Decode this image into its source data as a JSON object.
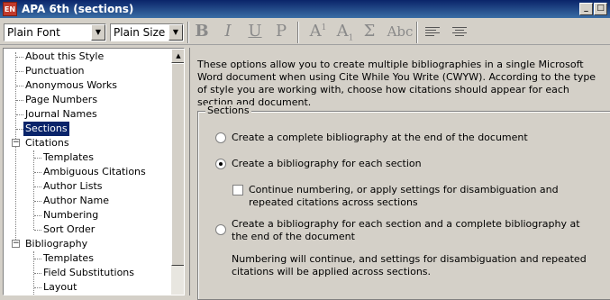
{
  "window": {
    "title": "APA 6th (sections)",
    "app_icon_text": "EN",
    "minimize_glyph": "_",
    "restore_glyph": "□",
    "close_glyph": "✕"
  },
  "toolbar": {
    "font_combo": "Plain Font",
    "size_combo": "Plain Size",
    "dropdown_glyph": "▼",
    "bold": "B",
    "italic": "I",
    "underline": "U",
    "plain": "P",
    "superscript": "A",
    "superscript_mark": "1",
    "subscript": "A",
    "subscript_mark": "1",
    "symbol": "Σ",
    "small_caps": "Abc",
    "align_left_icon": "align-left-icon",
    "center_icon": "align-center-icon"
  },
  "tree": {
    "items": [
      "About this Style",
      "Punctuation",
      "Anonymous Works",
      "Page Numbers",
      "Journal Names",
      "Sections",
      "Citations",
      "Templates",
      "Ambiguous Citations",
      "Author Lists",
      "Author Name",
      "Numbering",
      "Sort Order",
      "Bibliography",
      "Templates",
      "Field Substitutions",
      "Layout"
    ],
    "selected": "Sections",
    "collapse_glyph": "−",
    "scroll_up_glyph": "▲",
    "scroll_down_glyph": "▼"
  },
  "panel": {
    "intro": "These options allow you to create multiple bibliographies in a single Microsoft Word document when using Cite While You Write (CWYW). According to the type of style you are working with, choose how citations should appear for each section and document.",
    "group_label": "Sections",
    "option1": "Create a complete bibliography at the end of the document",
    "option2": "Create a bibliography for each section",
    "checkbox_label": "Continue numbering, or apply settings for disambiguation and repeated citations across sections",
    "option3": "Create a bibliography for each section and a complete bibliography at the end of the document",
    "note": "Numbering will continue, and settings for disambiguation and repeated citations will be applied across sections.",
    "selected_option": 2,
    "checkbox_checked": false
  }
}
